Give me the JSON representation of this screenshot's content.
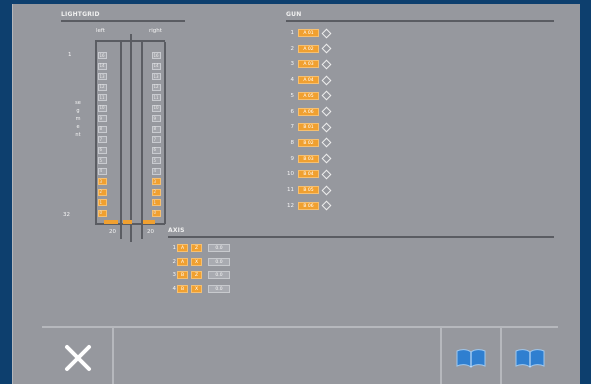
{
  "lightgrid": {
    "title": "LIGHTGRID",
    "col_left": "left",
    "col_right": "right",
    "top_index": "1",
    "bottom_index": "32",
    "vertical_label": "segment",
    "foot_left": "20",
    "foot_right": "20",
    "rows": [
      {
        "l": "16",
        "r": "16",
        "lon": false,
        "ron": false
      },
      {
        "l": "14",
        "r": "14",
        "lon": false,
        "ron": false
      },
      {
        "l": "13",
        "r": "13",
        "lon": false,
        "ron": false
      },
      {
        "l": "12",
        "r": "12",
        "lon": false,
        "ron": false
      },
      {
        "l": "11",
        "r": "11",
        "lon": false,
        "ron": false
      },
      {
        "l": "10",
        "r": "10",
        "lon": false,
        "ron": false
      },
      {
        "l": "9",
        "r": "9",
        "lon": false,
        "ron": false
      },
      {
        "l": "8",
        "r": "8",
        "lon": false,
        "ron": false
      },
      {
        "l": "7",
        "r": "7",
        "lon": false,
        "ron": false
      },
      {
        "l": "6",
        "r": "6",
        "lon": false,
        "ron": false
      },
      {
        "l": "5",
        "r": "5",
        "lon": false,
        "ron": false
      },
      {
        "l": "4",
        "r": "4",
        "lon": false,
        "ron": false
      },
      {
        "l": "3",
        "r": "3",
        "lon": true,
        "ron": true
      },
      {
        "l": "2",
        "r": "2",
        "lon": true,
        "ron": true
      },
      {
        "l": "1",
        "r": "1",
        "lon": true,
        "ron": true
      },
      {
        "l": "0",
        "r": "0",
        "lon": true,
        "ron": true
      }
    ]
  },
  "gun": {
    "title": "GUN",
    "rows": [
      {
        "n": "1",
        "chip": "A 01"
      },
      {
        "n": "2",
        "chip": "A 02"
      },
      {
        "n": "3",
        "chip": "A 03"
      },
      {
        "n": "4",
        "chip": "A 04"
      },
      {
        "n": "5",
        "chip": "A 05"
      },
      {
        "n": "6",
        "chip": "A 06"
      },
      {
        "n": "7",
        "chip": "B 01"
      },
      {
        "n": "8",
        "chip": "B 02"
      },
      {
        "n": "9",
        "chip": "B 03"
      },
      {
        "n": "10",
        "chip": "B 04"
      },
      {
        "n": "11",
        "chip": "B 05"
      },
      {
        "n": "12",
        "chip": "B 06"
      }
    ]
  },
  "axis": {
    "title": "AXIS",
    "rows": [
      {
        "n": "1",
        "a": "A",
        "b": "Z",
        "val": "0.0"
      },
      {
        "n": "2",
        "a": "A",
        "b": "X",
        "val": "0.0"
      },
      {
        "n": "3",
        "a": "B",
        "b": "Z",
        "val": "0.0"
      },
      {
        "n": "4",
        "a": "B",
        "b": "X",
        "val": "0.0"
      }
    ]
  },
  "colors": {
    "accent": "#f0a030",
    "panel": "#96989e",
    "frame": "#0d3f6e",
    "book_icon": "#2f7fd0"
  },
  "bottom": {
    "close_icon": "close-icon",
    "book_icon_1": "book-icon",
    "book_icon_2": "book-icon"
  }
}
